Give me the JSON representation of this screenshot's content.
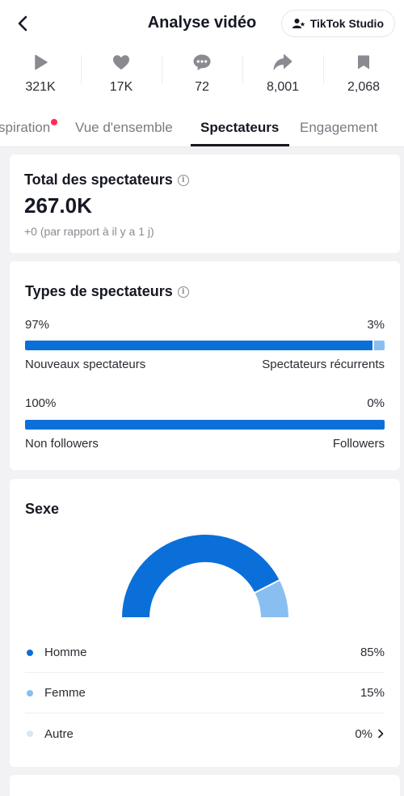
{
  "header": {
    "title": "Analyse vidéo",
    "studio_label": "TikTok Studio",
    "back_icon": "chevron-left-icon",
    "studio_icon": "person-star-icon"
  },
  "stats": [
    {
      "icon": "play-icon",
      "value": "321K"
    },
    {
      "icon": "heart-icon",
      "value": "17K"
    },
    {
      "icon": "comment-icon",
      "value": "72"
    },
    {
      "icon": "share-icon",
      "value": "8,001"
    },
    {
      "icon": "bookmark-icon",
      "value": "2,068"
    }
  ],
  "tabs": {
    "items": [
      "spiration",
      "Vue d'ensemble",
      "Spectateurs",
      "Engagement"
    ],
    "active": "Spectateurs"
  },
  "total": {
    "title": "Total des spectateurs",
    "value": "267.0K",
    "comparison": "+0  (par rapport à il y a 1 j)"
  },
  "types": {
    "title": "Types de spectateurs",
    "rows": [
      {
        "left_pct": "97%",
        "right_pct": "3%",
        "left_label": "Nouveaux spectateurs",
        "right_label": "Spectateurs récurrents",
        "fill_fraction": 0.97
      },
      {
        "left_pct": "100%",
        "right_pct": "0%",
        "left_label": "Non followers",
        "right_label": "Followers",
        "fill_fraction": 1.0
      }
    ]
  },
  "sexe": {
    "title": "Sexe",
    "legend": [
      {
        "name": "Homme",
        "value": "85%",
        "color": "#0b6fd9",
        "share": 0.85
      },
      {
        "name": "Femme",
        "value": "15%",
        "color": "#89bff0",
        "share": 0.15
      },
      {
        "name": "Autre",
        "value": "0%",
        "color": "#d6e7f8",
        "share": 0.0
      }
    ],
    "chevron_icon": "chevron-right-icon"
  },
  "colors": {
    "accent": "#0b6fd9",
    "accent_light": "#89bff0",
    "notification": "#fe2c55"
  }
}
